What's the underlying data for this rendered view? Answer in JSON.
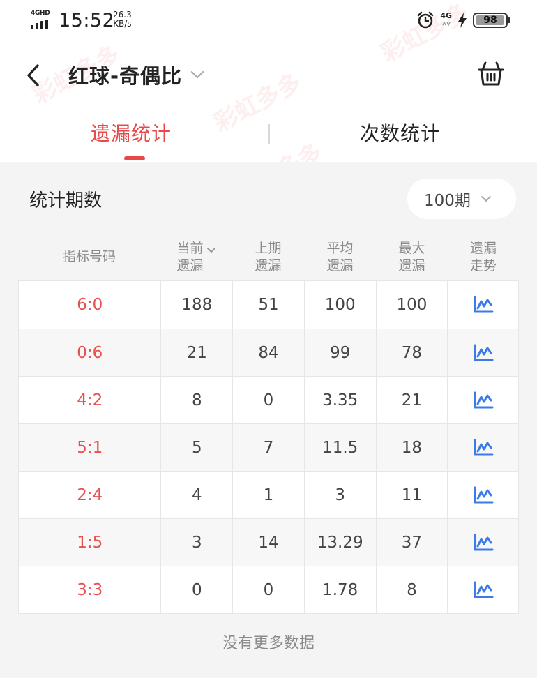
{
  "status_bar": {
    "network": "4GHD",
    "time": "15:52",
    "speed_value": "26.3",
    "speed_unit": "KB/s",
    "network_right": "4G",
    "battery": "98"
  },
  "header": {
    "title": "红球-奇偶比",
    "back_icon": "chevron-left-icon",
    "dropdown_icon": "chevron-down-icon",
    "cart_icon": "basket-icon"
  },
  "tabs": [
    {
      "label": "遗漏统计",
      "active": true
    },
    {
      "label": "次数统计",
      "active": false
    }
  ],
  "filter": {
    "label": "统计期数",
    "value": "100期"
  },
  "table": {
    "headers": [
      {
        "line1": "指标号码",
        "line2": ""
      },
      {
        "line1": "当前",
        "line2": "遗漏"
      },
      {
        "line1": "上期",
        "line2": "遗漏"
      },
      {
        "line1": "平均",
        "line2": "遗漏"
      },
      {
        "line1": "最大",
        "line2": "遗漏"
      },
      {
        "line1": "遗漏",
        "line2": "走势"
      }
    ],
    "rows": [
      {
        "code": "6:0",
        "current": "188",
        "previous": "51",
        "average": "100",
        "max": "100"
      },
      {
        "code": "0:6",
        "current": "21",
        "previous": "84",
        "average": "99",
        "max": "78"
      },
      {
        "code": "4:2",
        "current": "8",
        "previous": "0",
        "average": "3.35",
        "max": "21"
      },
      {
        "code": "5:1",
        "current": "5",
        "previous": "7",
        "average": "11.5",
        "max": "18"
      },
      {
        "code": "2:4",
        "current": "4",
        "previous": "1",
        "average": "3",
        "max": "11"
      },
      {
        "code": "1:5",
        "current": "3",
        "previous": "14",
        "average": "13.29",
        "max": "37"
      },
      {
        "code": "3:3",
        "current": "0",
        "previous": "0",
        "average": "1.78",
        "max": "8"
      }
    ],
    "trend_icon": "trend-chart-icon"
  },
  "footer": {
    "no_more": "没有更多数据"
  },
  "watermark_text": "彩虹多多",
  "colors": {
    "accent": "#e84848",
    "trend_icon": "#3b7be8",
    "muted": "#8a8a8a"
  }
}
